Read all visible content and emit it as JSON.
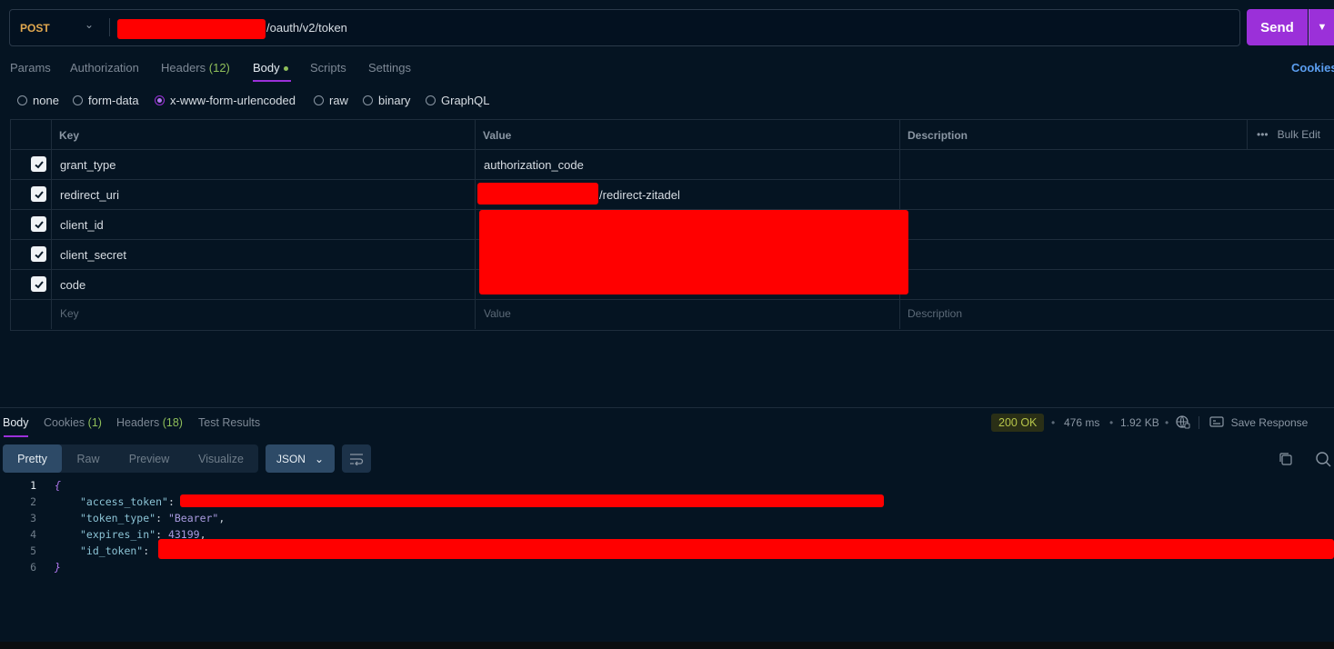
{
  "request": {
    "method": "POST",
    "url_suffix": "/oauth/v2/token",
    "send_label": "Send"
  },
  "request_tabs": [
    {
      "label": "Params"
    },
    {
      "label": "Authorization"
    },
    {
      "label": "Headers",
      "count": "(12)"
    },
    {
      "label": "Body",
      "active": true
    },
    {
      "label": "Scripts"
    },
    {
      "label": "Settings"
    }
  ],
  "cookies_link": "Cookies",
  "body_types": [
    "none",
    "form-data",
    "x-www-form-urlencoded",
    "raw",
    "binary",
    "GraphQL"
  ],
  "body_type_selected": "x-www-form-urlencoded",
  "table": {
    "headers": {
      "key": "Key",
      "value": "Value",
      "description": "Description"
    },
    "bulk_edit": "Bulk Edit",
    "rows": [
      {
        "key": "grant_type",
        "value": "authorization_code",
        "checked": true
      },
      {
        "key": "redirect_uri",
        "value": "/redirect-zitadel",
        "checked": true
      },
      {
        "key": "client_id",
        "value": "",
        "checked": true
      },
      {
        "key": "client_secret",
        "value": "",
        "checked": true
      },
      {
        "key": "code",
        "value": "",
        "checked": true
      }
    ],
    "placeholder": {
      "key": "Key",
      "value": "Value",
      "description": "Description"
    }
  },
  "response_tabs": [
    {
      "label": "Body",
      "active": true
    },
    {
      "label": "Cookies",
      "count": "(1)"
    },
    {
      "label": "Headers",
      "count": "(18)"
    },
    {
      "label": "Test Results"
    }
  ],
  "response_meta": {
    "status": "200 OK",
    "time": "476 ms",
    "size": "1.92 KB",
    "save_label": "Save Response"
  },
  "view_modes": [
    "Pretty",
    "Raw",
    "Preview",
    "Visualize"
  ],
  "view_mode_selected": "Pretty",
  "format": "JSON",
  "code_lines": {
    "l1": "{",
    "l2_key": "\"access_token\"",
    "l3_key": "\"token_type\"",
    "l3_val": "\"Bearer\"",
    "l4_key": "\"expires_in\"",
    "l4_val": "43199",
    "l5_key": "\"id_token\"",
    "l6": "}"
  },
  "line_numbers": [
    "1",
    "2",
    "3",
    "4",
    "5",
    "6"
  ],
  "colors": {
    "accent": "#9b30d9",
    "method": "#e0a84f",
    "status": "#b6c54a",
    "redaction": "#ff0000"
  }
}
